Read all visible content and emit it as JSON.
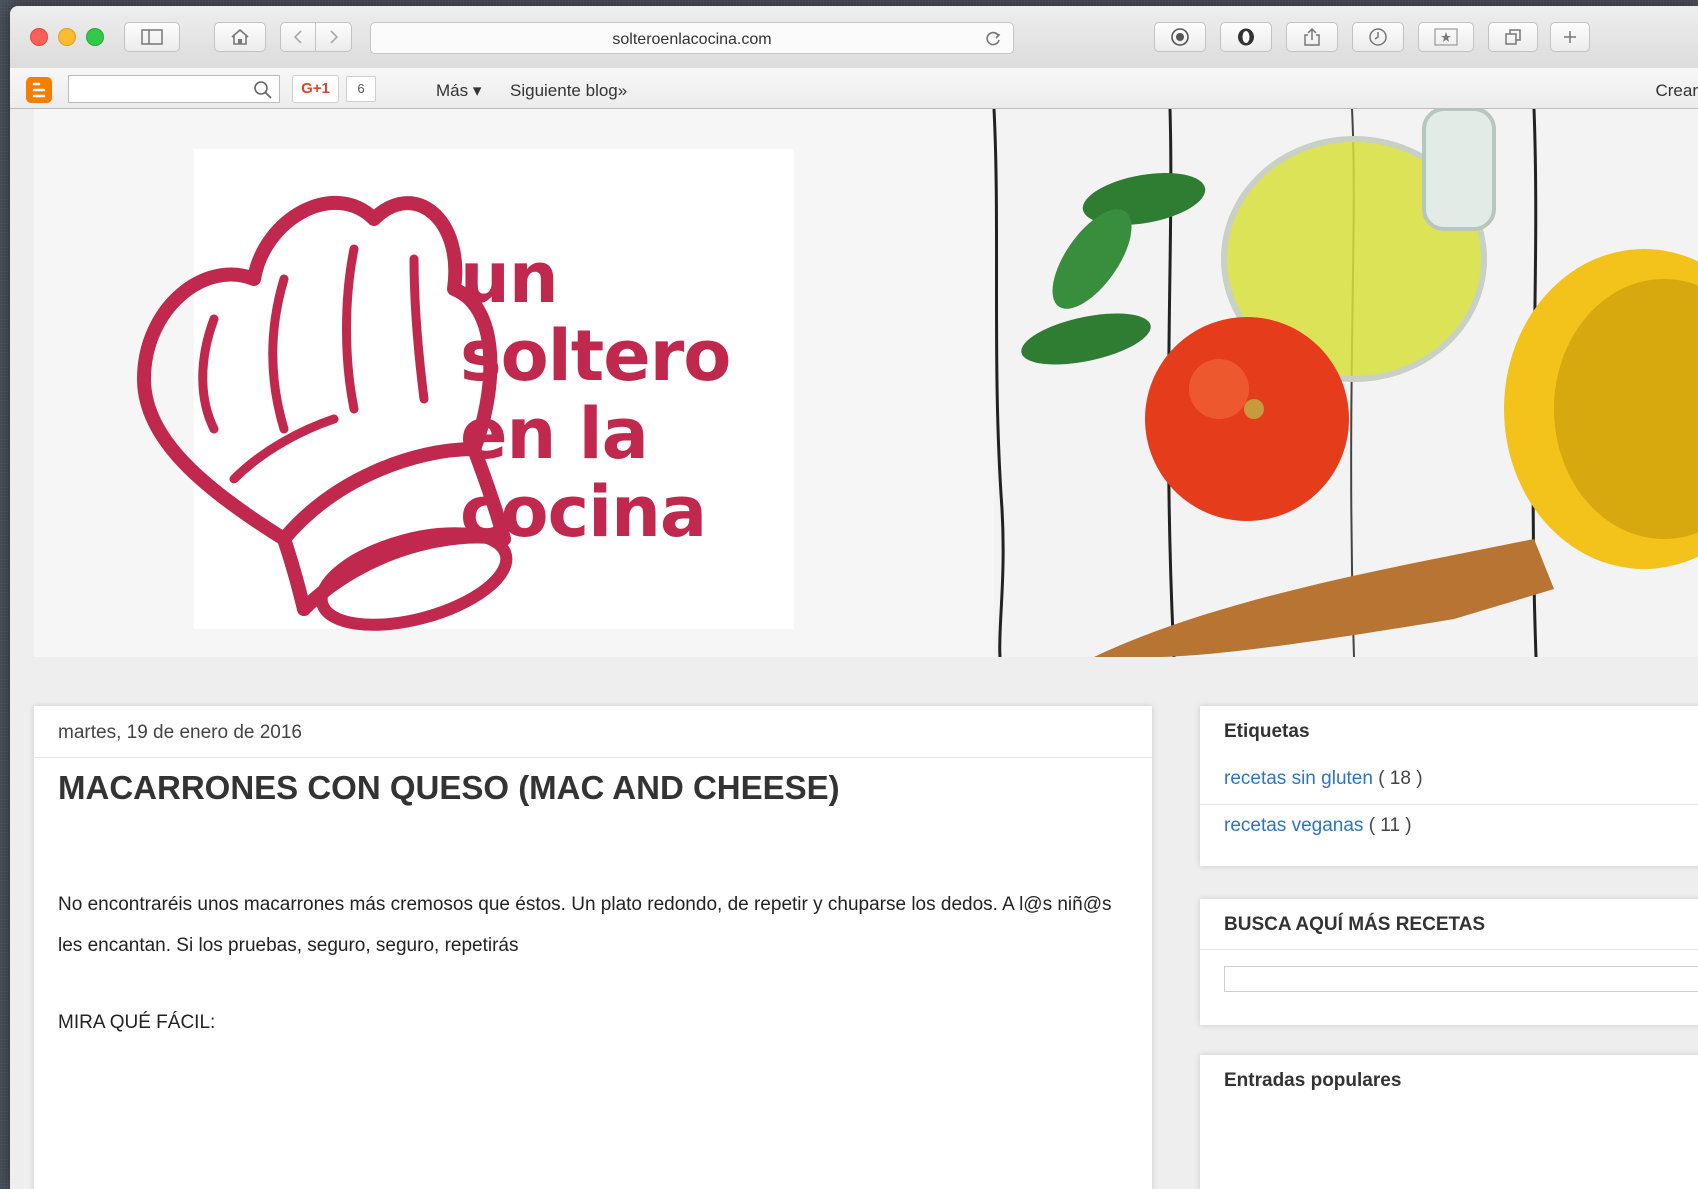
{
  "browser": {
    "url": "solteroenlacocina.com"
  },
  "blogger_bar": {
    "gplus_label": "G+1",
    "gplus_count": "6",
    "more_label": "Más ▾",
    "next_blog_label": "Siguiente blog»",
    "create_label": "Crear"
  },
  "header": {
    "logo_lines": [
      "un",
      "soltero",
      "en la",
      "cocina"
    ],
    "brand_color": "#c0284e"
  },
  "post": {
    "date": "martes, 19 de enero de 2016",
    "title": "MACARRONES CON QUESO (MAC AND CHEESE)",
    "intro": "No encontraréis unos macarrones más cremosos que éstos. Un plato redondo, de repetir y chuparse los dedos. A l@s niñ@s les encantan. Si los pruebas, seguro, seguro, repetirás",
    "mira": "MIRA QUÉ FÁCIL:"
  },
  "sidebar": {
    "labels_title": "Etiquetas",
    "labels": [
      {
        "name": "recetas sin gluten",
        "count": "( 18 )"
      },
      {
        "name": "recetas veganas",
        "count": "( 11 )"
      }
    ],
    "search_title": "BUSCA AQUÍ MÁS RECETAS",
    "popular_title": "Entradas populares"
  },
  "colors": {
    "link": "#2b74c8",
    "accent": "#c0284e"
  }
}
